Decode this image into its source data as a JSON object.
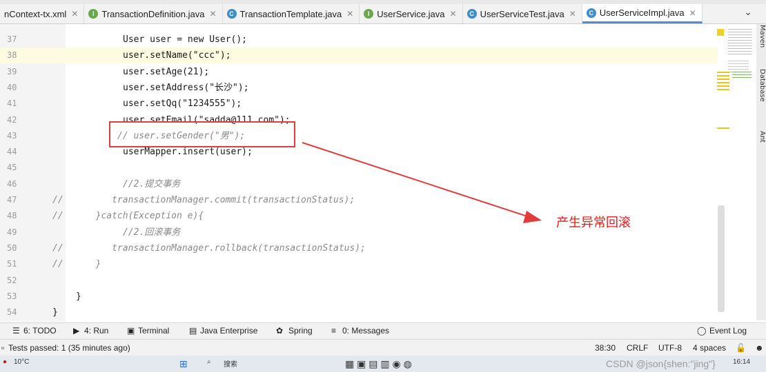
{
  "tabs": [
    {
      "label": "nContext-tx.xml",
      "kind": "xml",
      "active": false
    },
    {
      "label": "TransactionDefinition.java",
      "kind": "interface",
      "active": false
    },
    {
      "label": "TransactionTemplate.java",
      "kind": "class",
      "active": false
    },
    {
      "label": "UserService.java",
      "kind": "interface",
      "active": false
    },
    {
      "label": "UserServiceTest.java",
      "kind": "class",
      "active": false
    },
    {
      "label": "UserServiceImpl.java",
      "kind": "class",
      "active": true
    }
  ],
  "code_lines": [
    {
      "num": "37",
      "text": "User user = new User();"
    },
    {
      "num": "38",
      "text": "user.setName(\"ccc\");"
    },
    {
      "num": "39",
      "text": "user.setAge(21);"
    },
    {
      "num": "40",
      "text": "user.setAddress(\"长沙\");"
    },
    {
      "num": "41",
      "text": "user.setQq(\"1234555\");"
    },
    {
      "num": "42",
      "text": "user.setEmail(\"sadda@111.com\");"
    },
    {
      "num": "43",
      "text": "// user.setGender(\"男\");"
    },
    {
      "num": "44",
      "text": "userMapper.insert(user);"
    },
    {
      "num": "45",
      "text": ""
    },
    {
      "num": "46",
      "text": "//2.提交事务"
    },
    {
      "num": "47",
      "text": "//         transactionManager.commit(transactionStatus);"
    },
    {
      "num": "48",
      "text": "//      }catch(Exception e){"
    },
    {
      "num": "49",
      "text": "//2.回滚事务"
    },
    {
      "num": "50",
      "text": "//         transactionManager.rollback(transactionStatus);"
    },
    {
      "num": "51",
      "text": "//      }"
    },
    {
      "num": "52",
      "text": ""
    },
    {
      "num": "53",
      "text": "}"
    },
    {
      "num": "54",
      "text": "}"
    }
  ],
  "annotation": "产生异常回滚",
  "tool_windows": [
    "6: TODO",
    "4: Run",
    "Terminal",
    "Java Enterprise",
    "Spring",
    "0: Messages",
    "Event Log"
  ],
  "status": {
    "message": "Tests passed: 1 (35 minutes ago)",
    "position": "38:30",
    "line_sep": "CRLF",
    "encoding": "UTF-8",
    "indent": "4 spaces"
  },
  "right_sidebar": [
    "Maven",
    "Database",
    "Ant"
  ],
  "taskbar": {
    "temperature": "10°C",
    "search_placeholder": "搜索",
    "time": "16:14",
    "watermark": "CSDN @json{shen:\"jing\"}"
  },
  "colors": {
    "accent": "#4a8fd8",
    "annotation_red": "#e21b1b"
  }
}
